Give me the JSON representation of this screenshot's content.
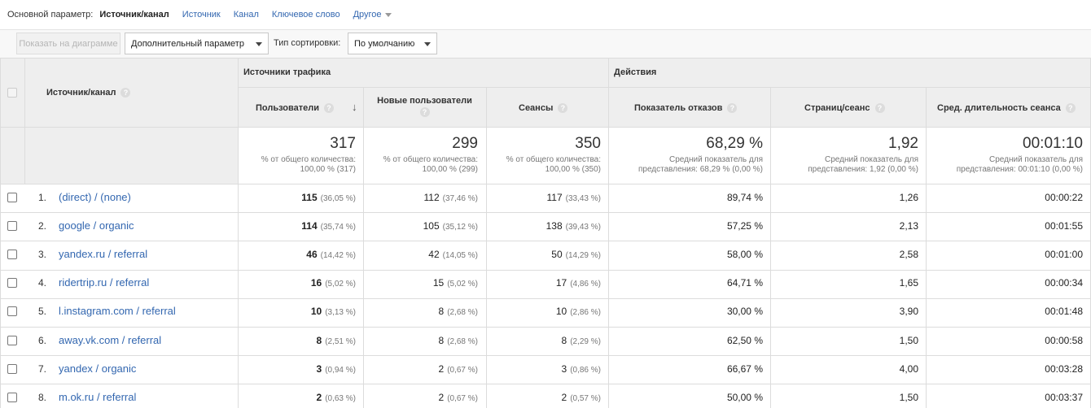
{
  "dimension_bar": {
    "label": "Основной параметр:",
    "current": "Источник/канал",
    "links": [
      "Источник",
      "Канал",
      "Ключевое слово"
    ],
    "other": "Другое"
  },
  "toolbar": {
    "plot_button": "Показать на диаграмме",
    "secondary_dimension": "Дополнительный параметр",
    "sort_label": "Тип сортировки:",
    "sort_value": "По умолчанию"
  },
  "table": {
    "dimension_header": "Источник/канал",
    "group_acquisition": "Источники трафика",
    "group_behavior": "Действия",
    "columns": [
      "Пользователи",
      "Новые пользователи",
      "Сеансы",
      "Показатель отказов",
      "Страниц/сеанс",
      "Сред. длительность сеанса"
    ],
    "help_icon": "?",
    "totals": [
      {
        "value": "317",
        "line1": "% от общего количества:",
        "line2": "100,00 % (317)"
      },
      {
        "value": "299",
        "line1": "% от общего количества:",
        "line2": "100,00 % (299)"
      },
      {
        "value": "350",
        "line1": "% от общего количества:",
        "line2": "100,00 % (350)"
      },
      {
        "value": "68,29 %",
        "line1": "Средний показатель для",
        "line2": "представления: 68,29 % (0,00 %)"
      },
      {
        "value": "1,92",
        "line1": "Средний показатель для",
        "line2": "представления: 1,92 (0,00 %)"
      },
      {
        "value": "00:01:10",
        "line1": "Средний показатель для",
        "line2": "представления: 00:01:10 (0,00 %)"
      }
    ],
    "rows": [
      {
        "num": "1.",
        "source": "(direct) / (none)",
        "users": "115",
        "users_pct": "(36,05 %)",
        "new_users": "112",
        "new_users_pct": "(37,46 %)",
        "sessions": "117",
        "sessions_pct": "(33,43 %)",
        "bounce": "89,74 %",
        "pages": "1,26",
        "duration": "00:00:22"
      },
      {
        "num": "2.",
        "source": "google / organic",
        "users": "114",
        "users_pct": "(35,74 %)",
        "new_users": "105",
        "new_users_pct": "(35,12 %)",
        "sessions": "138",
        "sessions_pct": "(39,43 %)",
        "bounce": "57,25 %",
        "pages": "2,13",
        "duration": "00:01:55"
      },
      {
        "num": "3.",
        "source": "yandex.ru / referral",
        "users": "46",
        "users_pct": "(14,42 %)",
        "new_users": "42",
        "new_users_pct": "(14,05 %)",
        "sessions": "50",
        "sessions_pct": "(14,29 %)",
        "bounce": "58,00 %",
        "pages": "2,58",
        "duration": "00:01:00"
      },
      {
        "num": "4.",
        "source": "ridertrip.ru / referral",
        "users": "16",
        "users_pct": "(5,02 %)",
        "new_users": "15",
        "new_users_pct": "(5,02 %)",
        "sessions": "17",
        "sessions_pct": "(4,86 %)",
        "bounce": "64,71 %",
        "pages": "1,65",
        "duration": "00:00:34"
      },
      {
        "num": "5.",
        "source": "l.instagram.com / referral",
        "users": "10",
        "users_pct": "(3,13 %)",
        "new_users": "8",
        "new_users_pct": "(2,68 %)",
        "sessions": "10",
        "sessions_pct": "(2,86 %)",
        "bounce": "30,00 %",
        "pages": "3,90",
        "duration": "00:01:48"
      },
      {
        "num": "6.",
        "source": "away.vk.com / referral",
        "users": "8",
        "users_pct": "(2,51 %)",
        "new_users": "8",
        "new_users_pct": "(2,68 %)",
        "sessions": "8",
        "sessions_pct": "(2,29 %)",
        "bounce": "62,50 %",
        "pages": "1,50",
        "duration": "00:00:58"
      },
      {
        "num": "7.",
        "source": "yandex / organic",
        "users": "3",
        "users_pct": "(0,94 %)",
        "new_users": "2",
        "new_users_pct": "(0,67 %)",
        "sessions": "3",
        "sessions_pct": "(0,86 %)",
        "bounce": "66,67 %",
        "pages": "4,00",
        "duration": "00:03:28"
      },
      {
        "num": "8.",
        "source": "m.ok.ru / referral",
        "users": "2",
        "users_pct": "(0,63 %)",
        "new_users": "2",
        "new_users_pct": "(0,67 %)",
        "sessions": "2",
        "sessions_pct": "(0,57 %)",
        "bounce": "50,00 %",
        "pages": "1,50",
        "duration": "00:03:37"
      }
    ]
  }
}
